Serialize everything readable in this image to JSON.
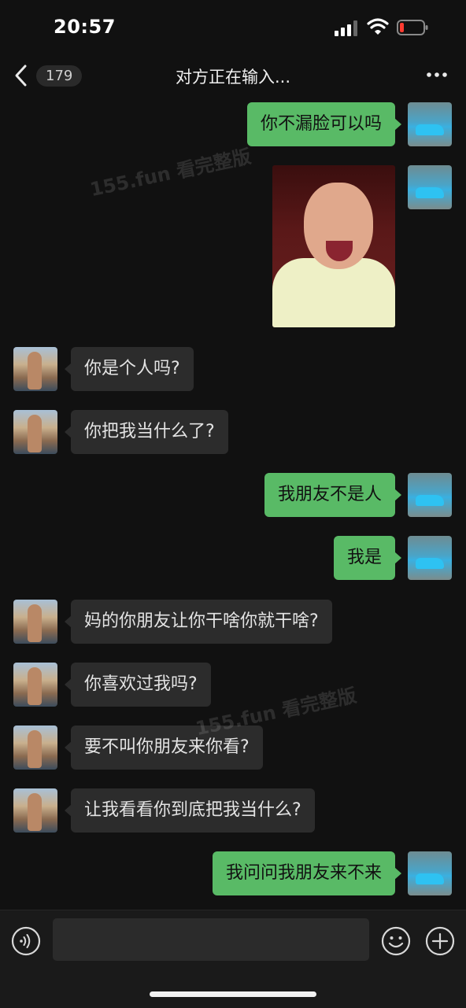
{
  "status_bar": {
    "time": "20:57",
    "signal_icon": "cellular-signal-icon",
    "wifi_icon": "wifi-icon",
    "battery_icon": "battery-low-icon",
    "battery_color": "#ff3b30"
  },
  "nav": {
    "back_icon": "chevron-left-icon",
    "unread_count": "179",
    "title": "对方正在输入...",
    "more_icon": "more-dots-icon"
  },
  "messages": [
    {
      "sender": "me",
      "type": "text",
      "text": "你不漏脸可以吗"
    },
    {
      "sender": "me",
      "type": "sticker",
      "description_icon": "laughing-baby-sticker"
    },
    {
      "sender": "other",
      "type": "text",
      "text": "你是个人吗?"
    },
    {
      "sender": "other",
      "type": "text",
      "text": "你把我当什么了?"
    },
    {
      "sender": "me",
      "type": "text",
      "text": "我朋友不是人"
    },
    {
      "sender": "me",
      "type": "text",
      "text": "我是"
    },
    {
      "sender": "other",
      "type": "text",
      "text": "妈的你朋友让你干啥你就干啥?"
    },
    {
      "sender": "other",
      "type": "text",
      "text": "你喜欢过我吗?"
    },
    {
      "sender": "other",
      "type": "text",
      "text": "要不叫你朋友来你看?"
    },
    {
      "sender": "other",
      "type": "text",
      "text": "让我看看你到底把我当什么?"
    },
    {
      "sender": "me",
      "type": "text",
      "text": "我问问我朋友来不来"
    }
  ],
  "watermarks": [
    "155.fun 看完整版",
    "155.fun 看完整版"
  ],
  "input_bar": {
    "voice_icon": "voice-input-icon",
    "text_value": "",
    "emoji_icon": "emoji-icon",
    "plus_icon": "plus-circle-icon"
  },
  "colors": {
    "background": "#111111",
    "my_bubble": "#59ba66",
    "their_bubble": "#2c2c2c"
  }
}
